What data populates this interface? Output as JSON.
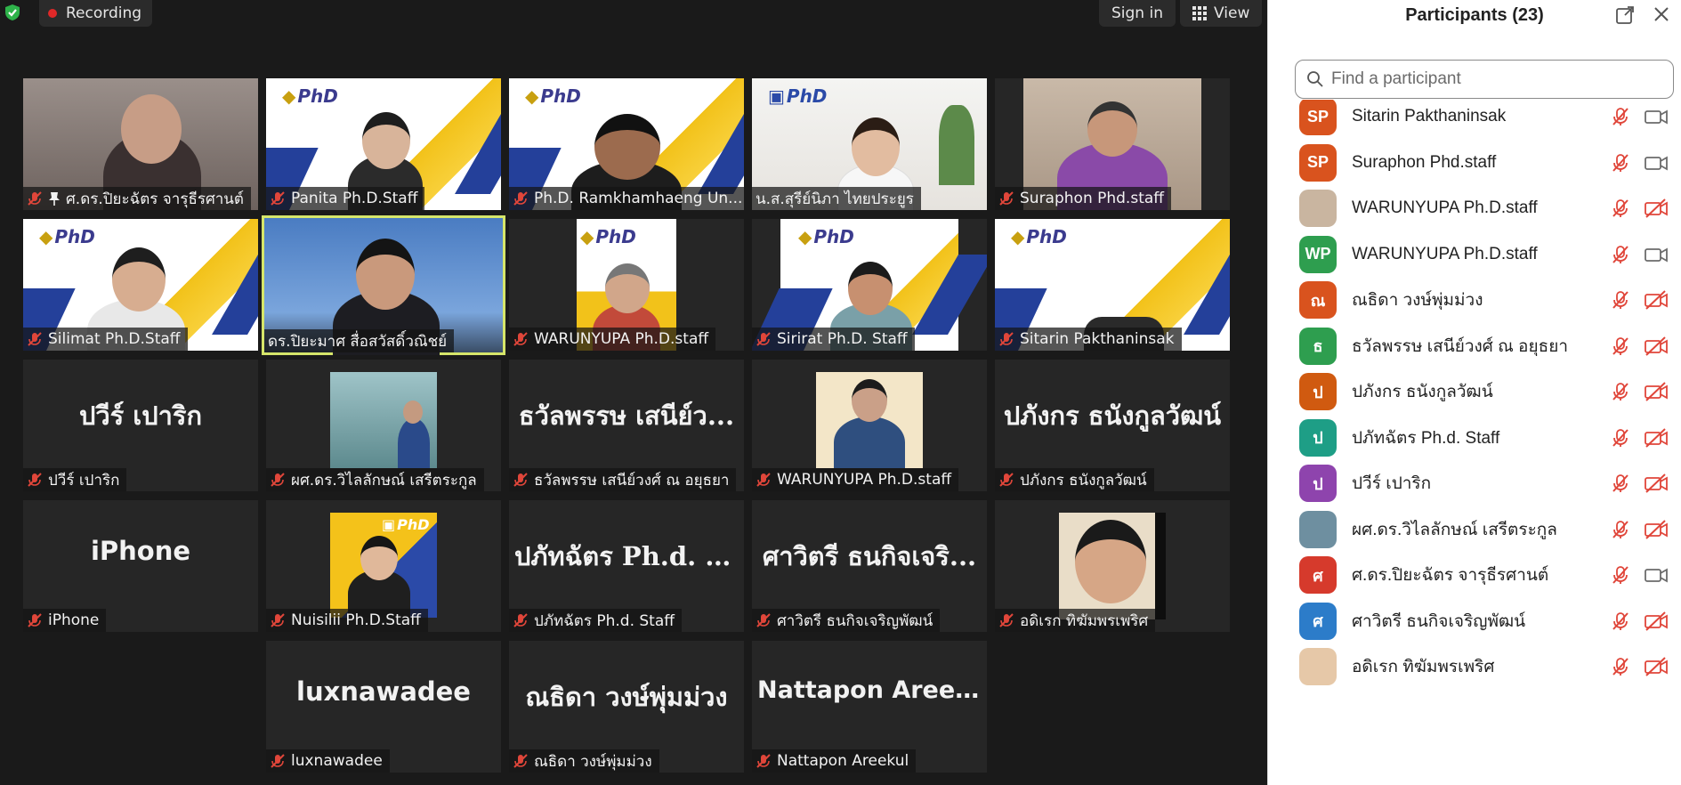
{
  "topbar": {
    "recording_label": "Recording",
    "sign_in_label": "Sign in",
    "view_label": "View"
  },
  "tiles": [
    {
      "name": "ศ.ดร.ปิยะฉัตร จารุธีรศานต์",
      "kind": "video"
    },
    {
      "name": "Panita Ph.D.Staff",
      "kind": "video"
    },
    {
      "name": "Ph.D. Ramkhamhaeng Un...",
      "kind": "video"
    },
    {
      "name": "น.ส.สุรีย์นิภา ไทยประยูร",
      "kind": "video"
    },
    {
      "name": "Suraphon Phd.staff",
      "kind": "video"
    },
    {
      "name": "Silimat Ph.D.Staff",
      "kind": "video"
    },
    {
      "name": "ดร.ปิยะมาศ สื่อสวัสดิ์วณิชย์",
      "kind": "video"
    },
    {
      "name": "WARUNYUPA Ph.D.staff",
      "kind": "video"
    },
    {
      "name": "Sirirat Ph.D. Staff",
      "kind": "video"
    },
    {
      "name": "Sitarin Pakthaninsak",
      "kind": "video"
    },
    {
      "name": "ปวีร์ เปาริก",
      "kind": "text",
      "big": "ปวีร์ เปาริก"
    },
    {
      "name": "ผศ.ดร.วิไลลักษณ์ เสรีตระกูล",
      "kind": "photo"
    },
    {
      "name": "ธวัลพรรษ เสนีย์วงศ์ ณ อยุธยา",
      "kind": "text",
      "big": "ธวัลพรรษ เสนีย์ว..."
    },
    {
      "name": "WARUNYUPA Ph.D.staff",
      "kind": "photo"
    },
    {
      "name": "ปภังกร ธนังกูลวัฒน์",
      "kind": "text",
      "big": "ปภังกร ธนังกูลวัฒน์"
    },
    {
      "name": "iPhone",
      "kind": "text",
      "big": "iPhone"
    },
    {
      "name": "Nuisilii Ph.D.Staff",
      "kind": "photo"
    },
    {
      "name": "ปภัทฉัตร Ph.d. Staff",
      "kind": "text",
      "big": "ปภัทฉัตร Ph.d. S..."
    },
    {
      "name": "ศาวิตรี ธนกิจเจริญพัฒน์",
      "kind": "text",
      "big": "ศาวิตรี ธนกิจเจริ..."
    },
    {
      "name": "อดิเรก ทิฆัมพรเพริศ",
      "kind": "photo"
    },
    {
      "name": "luxnawadee",
      "kind": "text",
      "big": "luxnawadee"
    },
    {
      "name": "ณธิดา วงษ์พุ่มม่วง",
      "kind": "text",
      "big": "ณธิดา วงษ์พุ่มม่วง"
    },
    {
      "name": "Nattapon Areekul",
      "kind": "text",
      "big": "Nattapon Areekul"
    }
  ],
  "phd_logo_text": "PhD",
  "panel": {
    "title": "Participants (23)",
    "search_placeholder": "Find a participant",
    "participants": [
      {
        "initials": "SP",
        "color": "#d9531e",
        "name": "Sitarin Pakthaninsak",
        "cam_on": true
      },
      {
        "initials": "SP",
        "color": "#d9531e",
        "name": "Suraphon Phd.staff",
        "cam_on": true
      },
      {
        "initials": "",
        "color": "#c9b5a0",
        "name": "WARUNYUPA Ph.D.staff",
        "cam_on": false
      },
      {
        "initials": "WP",
        "color": "#2e9e4f",
        "name": "WARUNYUPA Ph.D.staff",
        "cam_on": true
      },
      {
        "initials": "ณ",
        "color": "#d9531e",
        "name": "ณธิดา วงษ์พุ่มม่วง",
        "cam_on": false
      },
      {
        "initials": "ธ",
        "color": "#2e9e4f",
        "name": "ธวัลพรรษ เสนีย์วงศ์ ณ อยุธยา",
        "cam_on": false
      },
      {
        "initials": "ป",
        "color": "#d05a10",
        "name": "ปภังกร ธนังกูลวัฒน์",
        "cam_on": false
      },
      {
        "initials": "ป",
        "color": "#1e9e86",
        "name": "ปภัทฉัตร Ph.d. Staff",
        "cam_on": false
      },
      {
        "initials": "ป",
        "color": "#8e44ad",
        "name": "ปวีร์ เปาริก",
        "cam_on": false
      },
      {
        "initials": "",
        "color": "#6e8fa0",
        "name": "ผศ.ดร.วิไลลักษณ์ เสรีตระกูล",
        "cam_on": false
      },
      {
        "initials": "ศ",
        "color": "#d63a2c",
        "name": "ศ.ดร.ปิยะฉัตร จารุธีรศานต์",
        "cam_on": true
      },
      {
        "initials": "ศ",
        "color": "#2c7cc9",
        "name": "ศาวิตรี ธนกิจเจริญพัฒน์",
        "cam_on": false
      },
      {
        "initials": "",
        "color": "#e6c8a8",
        "name": "อดิเรก ทิฆัมพรเพริศ",
        "cam_on": false
      }
    ]
  }
}
